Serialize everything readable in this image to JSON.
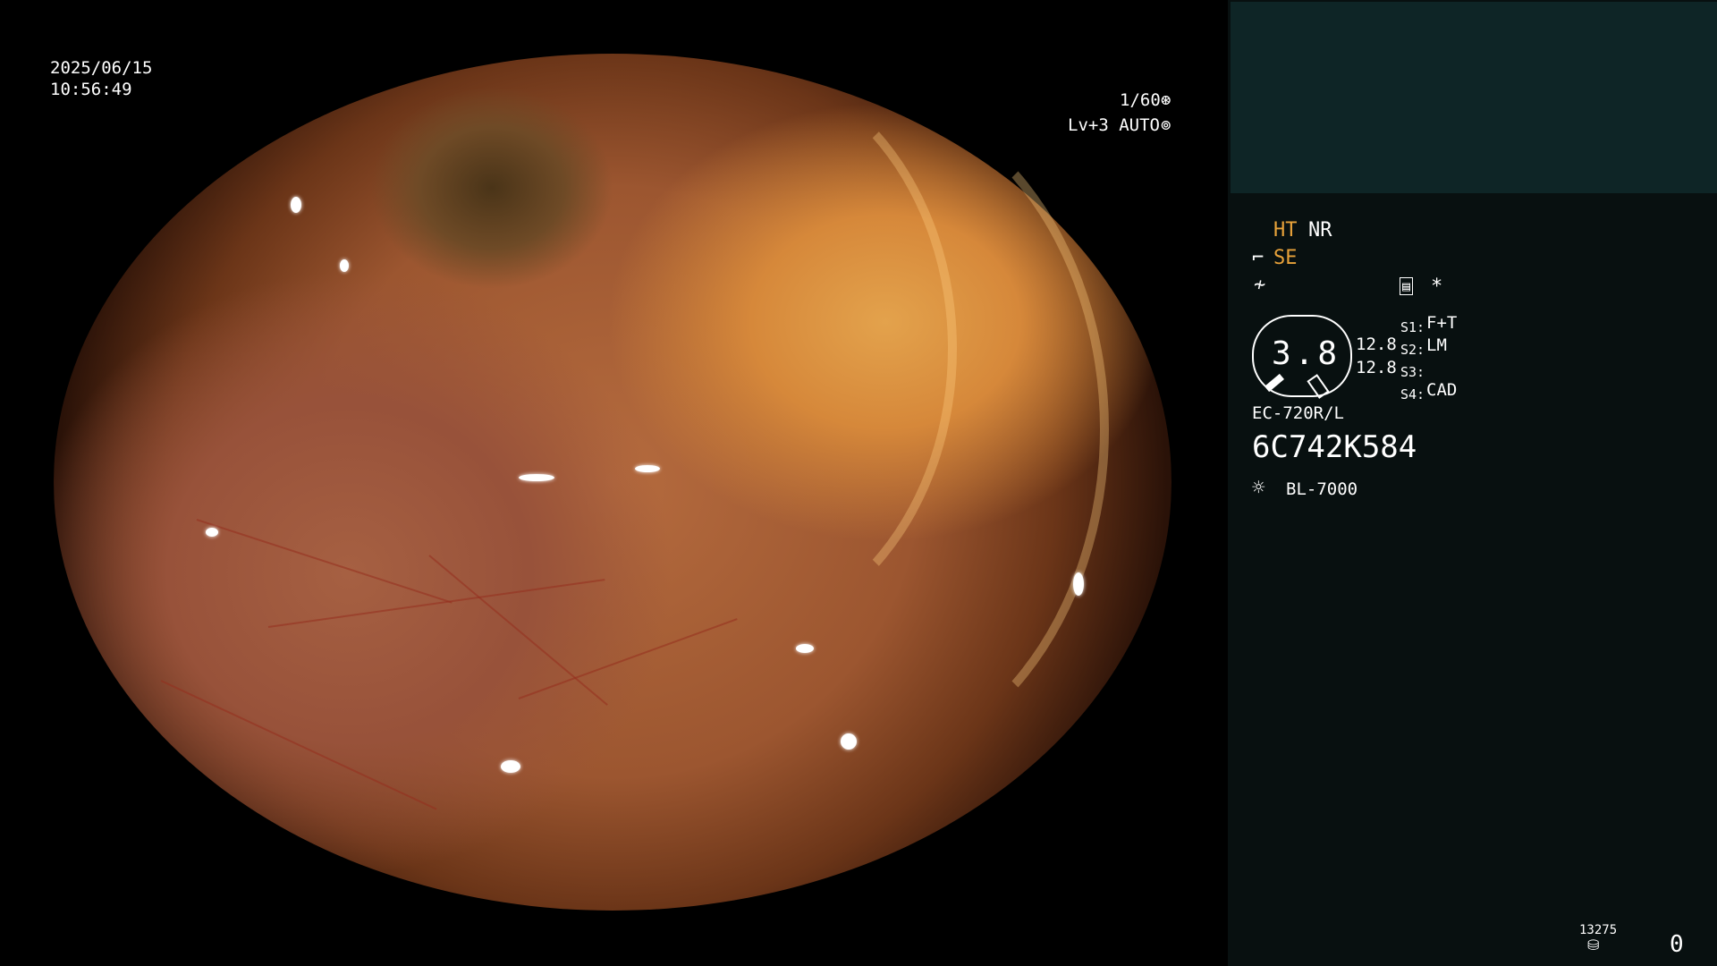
{
  "osd": {
    "date": "2025/06/15",
    "time": "10:56:49",
    "shutter": "1/60",
    "shutter_icon": "shutter-icon",
    "level": "Lv+3 AUTO",
    "iris_icon": "iris-icon"
  },
  "panel": {
    "mode_ht": "HT",
    "mode_nr": "NR",
    "se_label": "SE",
    "zoom_value": "3.8",
    "value_top": "12.8",
    "value_bottom": "12.8",
    "s1_key": "S1:",
    "s1_val": "F+T",
    "s2_key": "S2:",
    "s2_val": "LM",
    "s3_key": "S3:",
    "s3_val": "",
    "s4_key": "S4:",
    "s4_val": "CAD",
    "asterisk": "*",
    "scope_model": "EC-720R/L",
    "serial": "6C742K584",
    "light_source": "BL-7000",
    "counter_small": "13275",
    "counter": "0"
  },
  "colors": {
    "accent_orange": "#e8a23a",
    "panel_bg": "#081010",
    "thumb_bg": "#0e2526"
  },
  "icons": [
    "se-icon",
    "freeze-icon",
    "record-icon",
    "light-icon",
    "disk-icon"
  ]
}
